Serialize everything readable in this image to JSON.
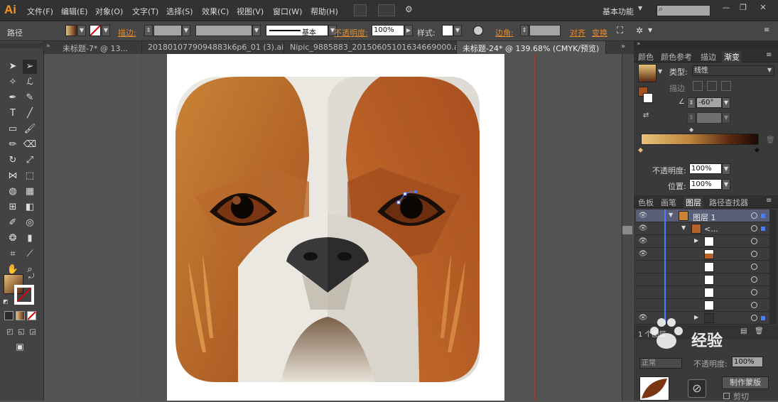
{
  "app": {
    "logo": "Ai"
  },
  "menu": [
    "文件(F)",
    "编辑(E)",
    "对象(O)",
    "文字(T)",
    "选择(S)",
    "效果(C)",
    "视图(V)",
    "窗口(W)",
    "帮助(H)"
  ],
  "workspace": "基本功能",
  "window_buttons": [
    "—",
    "❐",
    "✕"
  ],
  "control": {
    "selection_label": "路径",
    "stroke_label": "描边:",
    "stroke_style": "基本",
    "opacity_label": "不透明度:",
    "opacity_value": "100%",
    "style_label": "样式:",
    "corner_label": "边角:",
    "align_label": "对齐",
    "transform_label": "变换"
  },
  "tabs": [
    {
      "label": "未标题-7* @ 13..."
    },
    {
      "label": "201801077909488​3k6p6_01 (3).ai*"
    },
    {
      "label": "Nipic_9885883_20150605101634669000.ai*"
    },
    {
      "label": "未标题-24* @ 139.68% (CMYK/预览)"
    }
  ],
  "gradient_panel": {
    "tabs": [
      "颜色",
      "颜色参考",
      "描边",
      "渐变"
    ],
    "type_label": "类型:",
    "type_value": "线性",
    "stroke_label": "描边",
    "angle_value": "-60°",
    "opacity_label": "不透明度:",
    "opacity_value": "100%",
    "position_label": "位置:",
    "position_value": "100%"
  },
  "layers_panel": {
    "tabs": [
      "色板",
      "画笔",
      "图层",
      "路径查找器"
    ],
    "layer1_name": "图层 1",
    "group_name": "<...",
    "count_label": "1 个图层"
  },
  "transparency_panel": {
    "mode_value": "正常",
    "opacity_label": "不透明度:",
    "opacity_value": "100%",
    "mask_button": "制作蒙版",
    "clip_label": "剪切"
  },
  "watermark": {
    "text": "经验"
  },
  "colors": {
    "accent": "#f7941d",
    "link": "#e58b2d",
    "dog_brown": "#b8622a",
    "dog_white": "#ebe8e2",
    "nose": "#3a3a3a"
  }
}
